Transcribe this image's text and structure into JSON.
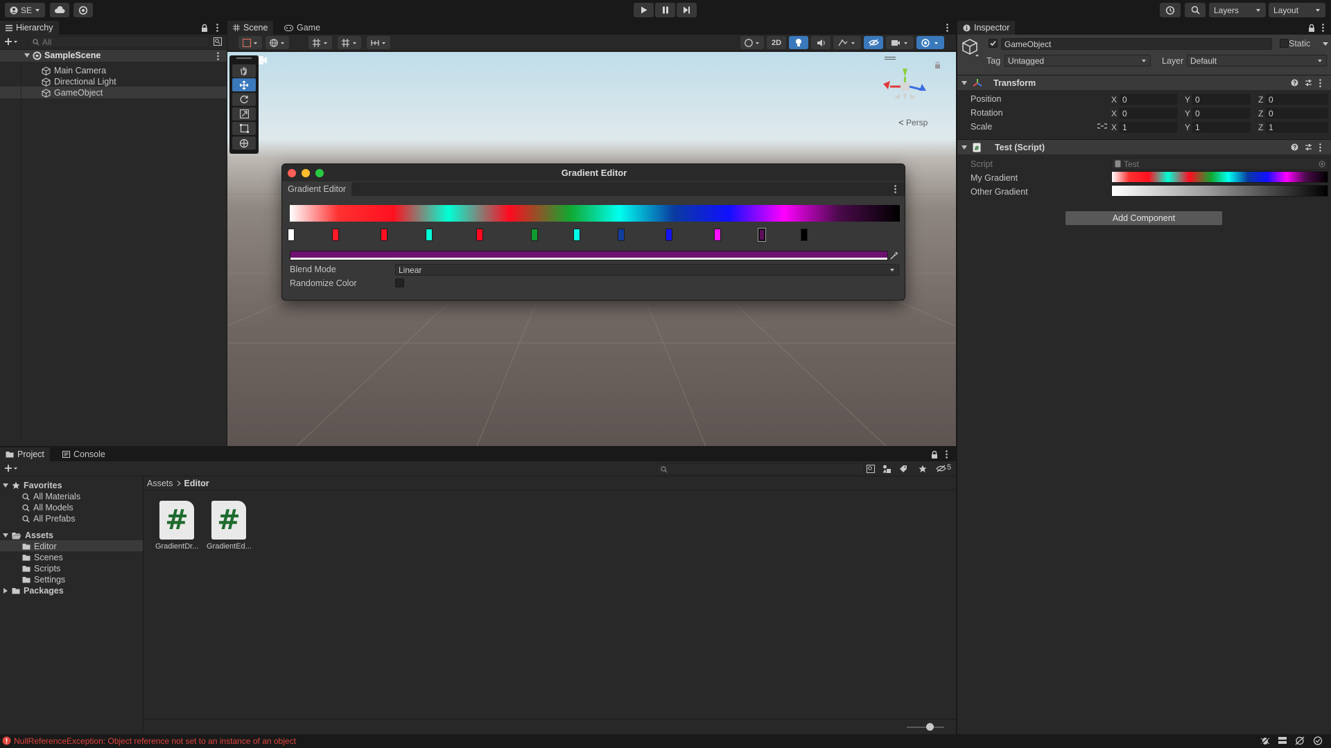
{
  "toolbar": {
    "account": "SE",
    "layers": "Layers",
    "layout": "Layout"
  },
  "hierarchy": {
    "tab": "Hierarchy",
    "search_placeholder": "All",
    "scene": "SampleScene",
    "items": [
      "Main Camera",
      "Directional Light",
      "GameObject"
    ]
  },
  "scene_tabs": {
    "scene": "Scene",
    "game": "Game"
  },
  "scene_toolbar": {
    "two_d": "2D"
  },
  "scene_view": {
    "persp": "Persp"
  },
  "gradient_editor": {
    "title": "Gradient Editor",
    "tab": "Gradient Editor",
    "stops": [
      "#ffffff",
      "#ff1a2a",
      "#ff1020",
      "#00ffd5",
      "#ff0a20",
      "#119a2e",
      "#00ffe8",
      "#123e9a",
      "#1414ee",
      "#ff10ff",
      "#5e0e5e",
      "#000000"
    ],
    "selected_color": "#6e1170",
    "blend_mode_label": "Blend Mode",
    "blend_mode_value": "Linear",
    "randomize_label": "Randomize Color"
  },
  "inspector": {
    "tab": "Inspector",
    "object_name": "GameObject",
    "static_label": "Static",
    "tag_label": "Tag",
    "tag_value": "Untagged",
    "layer_label": "Layer",
    "layer_value": "Default",
    "transform": {
      "title": "Transform",
      "position_label": "Position",
      "rotation_label": "Rotation",
      "scale_label": "Scale",
      "position": [
        "0",
        "0",
        "0"
      ],
      "rotation": [
        "0",
        "0",
        "0"
      ],
      "scale": [
        "1",
        "1",
        "1"
      ],
      "axes": [
        "X",
        "Y",
        "Z"
      ]
    },
    "script_component": {
      "title": "Test (Script)",
      "script_label": "Script",
      "script_value": "Test",
      "my_gradient_label": "My Gradient",
      "other_gradient_label": "Other Gradient"
    },
    "add_component": "Add Component"
  },
  "project": {
    "tabs": [
      "Project",
      "Console"
    ],
    "favorites_label": "Favorites",
    "favorites": [
      "All Materials",
      "All Models",
      "All Prefabs"
    ],
    "assets_label": "Assets",
    "assets_folders": [
      "Editor",
      "Scenes",
      "Scripts",
      "Settings"
    ],
    "packages_label": "Packages",
    "breadcrumb": [
      "Assets",
      "Editor"
    ],
    "hidden_count": "5",
    "files": [
      "GradientDr...",
      "GradientEd..."
    ]
  },
  "status": {
    "message": "NullReferenceException: Object reference not set to an instance of an object"
  }
}
